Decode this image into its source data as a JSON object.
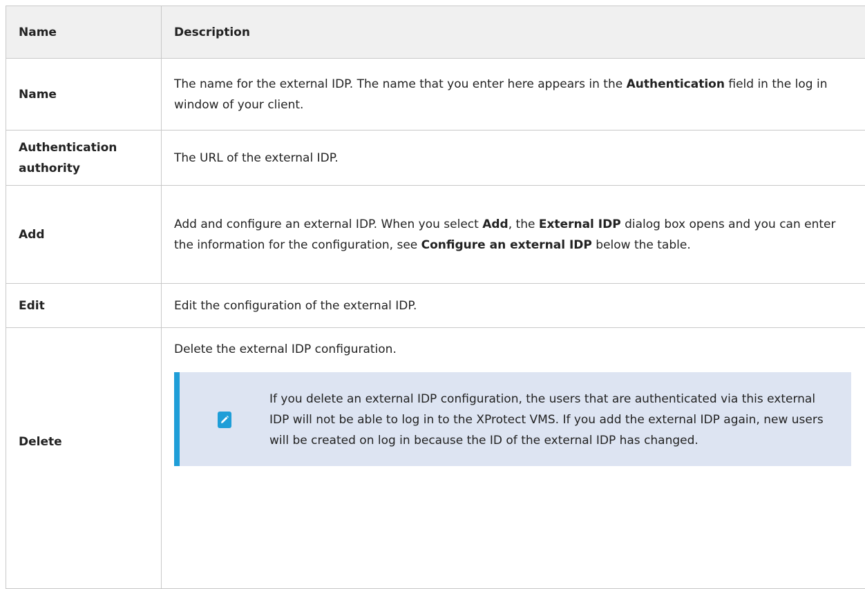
{
  "table": {
    "header": {
      "name": "Name",
      "description": "Description"
    },
    "rows": {
      "name": {
        "label": "Name",
        "desc_part1": "The name for the external IDP. The name that you enter here appears in the ",
        "desc_bold1": "Authentication",
        "desc_part2": " field in the log in window of your client."
      },
      "auth": {
        "label_line1": "Authentication",
        "label_line2": "authority",
        "desc": "The URL of the external IDP."
      },
      "add": {
        "label": "Add",
        "desc_part1": "Add and configure an external IDP. When you select ",
        "desc_bold1": "Add",
        "desc_part2": ", the ",
        "desc_bold2": "External IDP",
        "desc_part3": " dialog box opens and you can enter the information for the configuration, see ",
        "desc_bold3": "Configure an external IDP",
        "desc_part4": " below the table."
      },
      "edit": {
        "label": "Edit",
        "desc": "Edit the configuration of the external IDP."
      },
      "delete": {
        "label": "Delete",
        "desc": "Delete the external IDP configuration.",
        "note": "If you delete an external IDP configuration, the users that are authenticated via this external IDP will not be able to log in to the XProtect VMS. If you add the external IDP again, new users will be created on log in because the ID of the external IDP has changed."
      }
    }
  },
  "colors": {
    "note_background": "#dde4f2",
    "note_accent": "#1f9ed8",
    "header_background": "#f0f0f0",
    "border": "#c8c8c8"
  },
  "icons": {
    "note": "pencil-icon"
  }
}
